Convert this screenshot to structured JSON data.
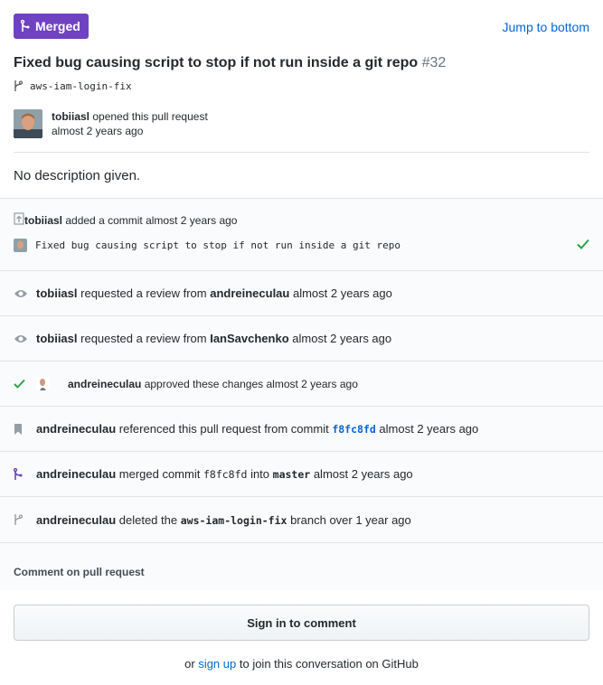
{
  "header": {
    "state_label": "Merged",
    "jump_label": "Jump to bottom",
    "title": "Fixed bug causing script to stop if not run inside a git repo",
    "number": "#32",
    "branch": "aws-iam-login-fix"
  },
  "opener": {
    "user": "tobiiasl",
    "action": "opened this pull request",
    "time": "almost 2 years ago"
  },
  "description": "No description given.",
  "timeline": {
    "commit_event": {
      "user": "tobiiasl",
      "action": "added a commit",
      "time": "almost 2 years ago",
      "commit_message": "Fixed bug causing script to stop if not run inside a git repo"
    },
    "review_request_1": {
      "user": "tobiiasl",
      "action": "requested a review from",
      "reviewer": "andreineculau",
      "time": "almost 2 years ago"
    },
    "review_request_2": {
      "user": "tobiiasl",
      "action": "requested a review from",
      "reviewer": "IanSavchenko",
      "time": "almost 2 years ago"
    },
    "approval": {
      "user": "andreineculau",
      "action": "approved these changes",
      "time": "almost 2 years ago"
    },
    "reference": {
      "user": "andreineculau",
      "action": "referenced this pull request from commit",
      "sha": "f8fc8fd",
      "time": "almost 2 years ago"
    },
    "merge": {
      "user": "andreineculau",
      "action": "merged commit",
      "sha": "f8fc8fd",
      "into": "into",
      "target_branch": "master",
      "time": "almost 2 years ago"
    },
    "delete_branch": {
      "user": "andreineculau",
      "action": "deleted the",
      "branch": "aws-iam-login-fix",
      "suffix": "branch",
      "time": "over 1 year ago"
    }
  },
  "comment": {
    "heading": "Comment on pull request",
    "signin_label": "Sign in to comment",
    "join_prefix": "or",
    "join_link": "sign up",
    "join_suffix": "to join this conversation on GitHub"
  },
  "colors": {
    "merged_purple": "#6f42c1",
    "link_blue": "#0366d6",
    "success_green": "#28a745"
  }
}
